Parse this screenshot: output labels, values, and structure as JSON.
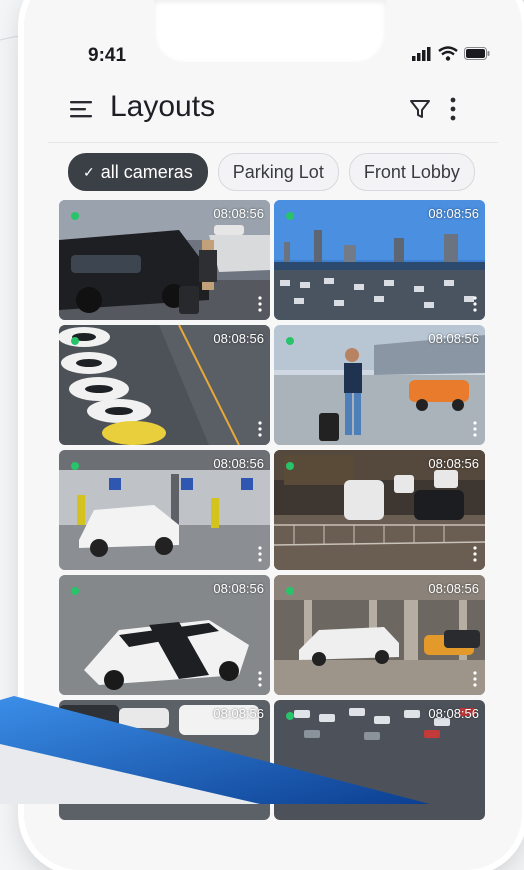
{
  "status": {
    "time": "9:41"
  },
  "header": {
    "title": "Layouts"
  },
  "chips": [
    {
      "label": "all cameras",
      "active": true
    },
    {
      "label": "Parking Lot",
      "active": false
    },
    {
      "label": "Front Lobby",
      "active": false
    }
  ],
  "tiles": [
    {
      "timestamp": "08:08:56",
      "scene": "cars-street"
    },
    {
      "timestamp": "08:08:56",
      "scene": "city-lot"
    },
    {
      "timestamp": "08:08:56",
      "scene": "aerial-parking"
    },
    {
      "timestamp": "08:08:56",
      "scene": "traveler-suitcase"
    },
    {
      "timestamp": "08:08:56",
      "scene": "garage-ev"
    },
    {
      "timestamp": "08:08:56",
      "scene": "garage-overhead"
    },
    {
      "timestamp": "08:08:56",
      "scene": "convertible"
    },
    {
      "timestamp": "08:08:56",
      "scene": "garage-cars"
    },
    {
      "timestamp": "08:08:56",
      "scene": "white-van"
    },
    {
      "timestamp": "08:08:56",
      "scene": "aerial-lot"
    }
  ],
  "colors": {
    "accent": "#1d6fd0",
    "status_online": "#27c46a",
    "chip_active": "#3b4046"
  }
}
